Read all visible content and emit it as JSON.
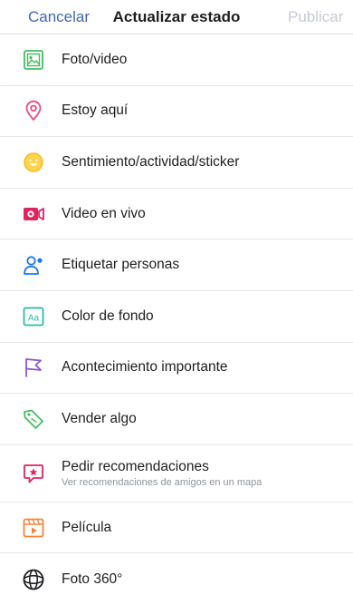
{
  "header": {
    "cancel_label": "Cancelar",
    "title": "Actualizar estado",
    "publish_label": "Publicar"
  },
  "colors": {
    "link": "#4267b2",
    "disabled": "#c5cad3",
    "photo": "#45bd62",
    "location": "#e84a7c",
    "feeling": "#f7b928",
    "live": "#e0245e",
    "tag": "#1877f2",
    "background_color": "#2abba7",
    "event": "#8c56d9",
    "sell": "#45bd62",
    "recommend": "#e0245e",
    "movie": "#f3853b"
  },
  "options": [
    {
      "label": "Foto/video",
      "icon": "photo-icon"
    },
    {
      "label": "Estoy aquí",
      "icon": "location-pin-icon"
    },
    {
      "label": "Sentimiento/actividad/sticker",
      "icon": "smiley-icon"
    },
    {
      "label": "Video en vivo",
      "icon": "live-video-icon"
    },
    {
      "label": "Etiquetar personas",
      "icon": "tag-people-icon"
    },
    {
      "label": "Color de fondo",
      "icon": "background-color-icon"
    },
    {
      "label": "Acontecimiento importante",
      "icon": "flag-icon"
    },
    {
      "label": "Vender algo",
      "icon": "price-tag-icon"
    },
    {
      "label": "Pedir recomendaciones",
      "sublabel": "Ver recomendaciones de amigos en un mapa",
      "icon": "recommendation-icon"
    },
    {
      "label": "Película",
      "icon": "movie-icon"
    },
    {
      "label": "Foto 360°",
      "icon": "photo-360-icon"
    }
  ]
}
